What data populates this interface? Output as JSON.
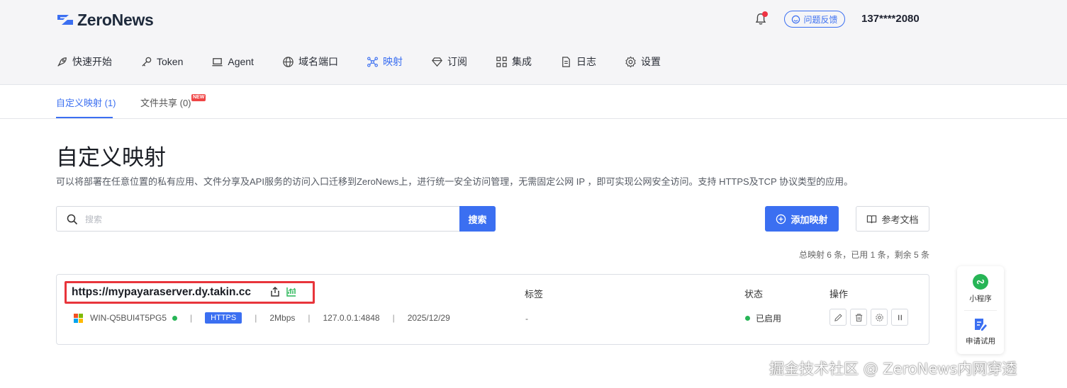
{
  "header": {
    "brand": "ZeroNews",
    "feedback_label": "问题反馈",
    "user": "137****2080"
  },
  "nav": [
    {
      "label": "快速开始",
      "icon": "rocket-icon"
    },
    {
      "label": "Token",
      "icon": "key-icon"
    },
    {
      "label": "Agent",
      "icon": "laptop-icon"
    },
    {
      "label": "域名端口",
      "icon": "globe-icon"
    },
    {
      "label": "映射",
      "icon": "mapping-icon",
      "active": true
    },
    {
      "label": "订阅",
      "icon": "diamond-icon"
    },
    {
      "label": "集成",
      "icon": "apps-icon"
    },
    {
      "label": "日志",
      "icon": "document-icon"
    },
    {
      "label": "设置",
      "icon": "gear-icon"
    }
  ],
  "subtabs": {
    "custom": "自定义映射 (1)",
    "files": "文件共享 (0)",
    "new_badge": "NEW"
  },
  "page": {
    "title": "自定义映射",
    "description": "可以将部署在任意位置的私有应用、文件分享及API服务的访问入口迁移到ZeroNews上，进行统一安全访问管理，无需固定公网 IP ，即可实现公网安全访问。支持 HTTPS及TCP 协议类型的应用。"
  },
  "search": {
    "placeholder": "搜索",
    "button": "搜索"
  },
  "actions": {
    "add": "添加映射",
    "docs": "参考文档"
  },
  "summary": "总映射 6 条，已用 1 条，剩余 5 条",
  "columns": {
    "tag": "标签",
    "status": "状态",
    "ops": "操作"
  },
  "mapping": {
    "domain": "https://mypayaraserver.dy.takin.cc",
    "agent": "WIN-Q5BUI4T5PG5",
    "protocol": "HTTPS",
    "bandwidth": "2Mbps",
    "target": "127.0.0.1:4848",
    "expiry": "2025/12/29",
    "tag": "-",
    "status": "已启用"
  },
  "float_panel": {
    "mini_program": "小程序",
    "trial": "申请试用"
  },
  "watermark": "掘金技术社区 @ ZeroNews内网穿透",
  "colors": {
    "accent": "#3b6ff1",
    "highlight_border": "#e8353b",
    "status_green": "#27b556"
  }
}
